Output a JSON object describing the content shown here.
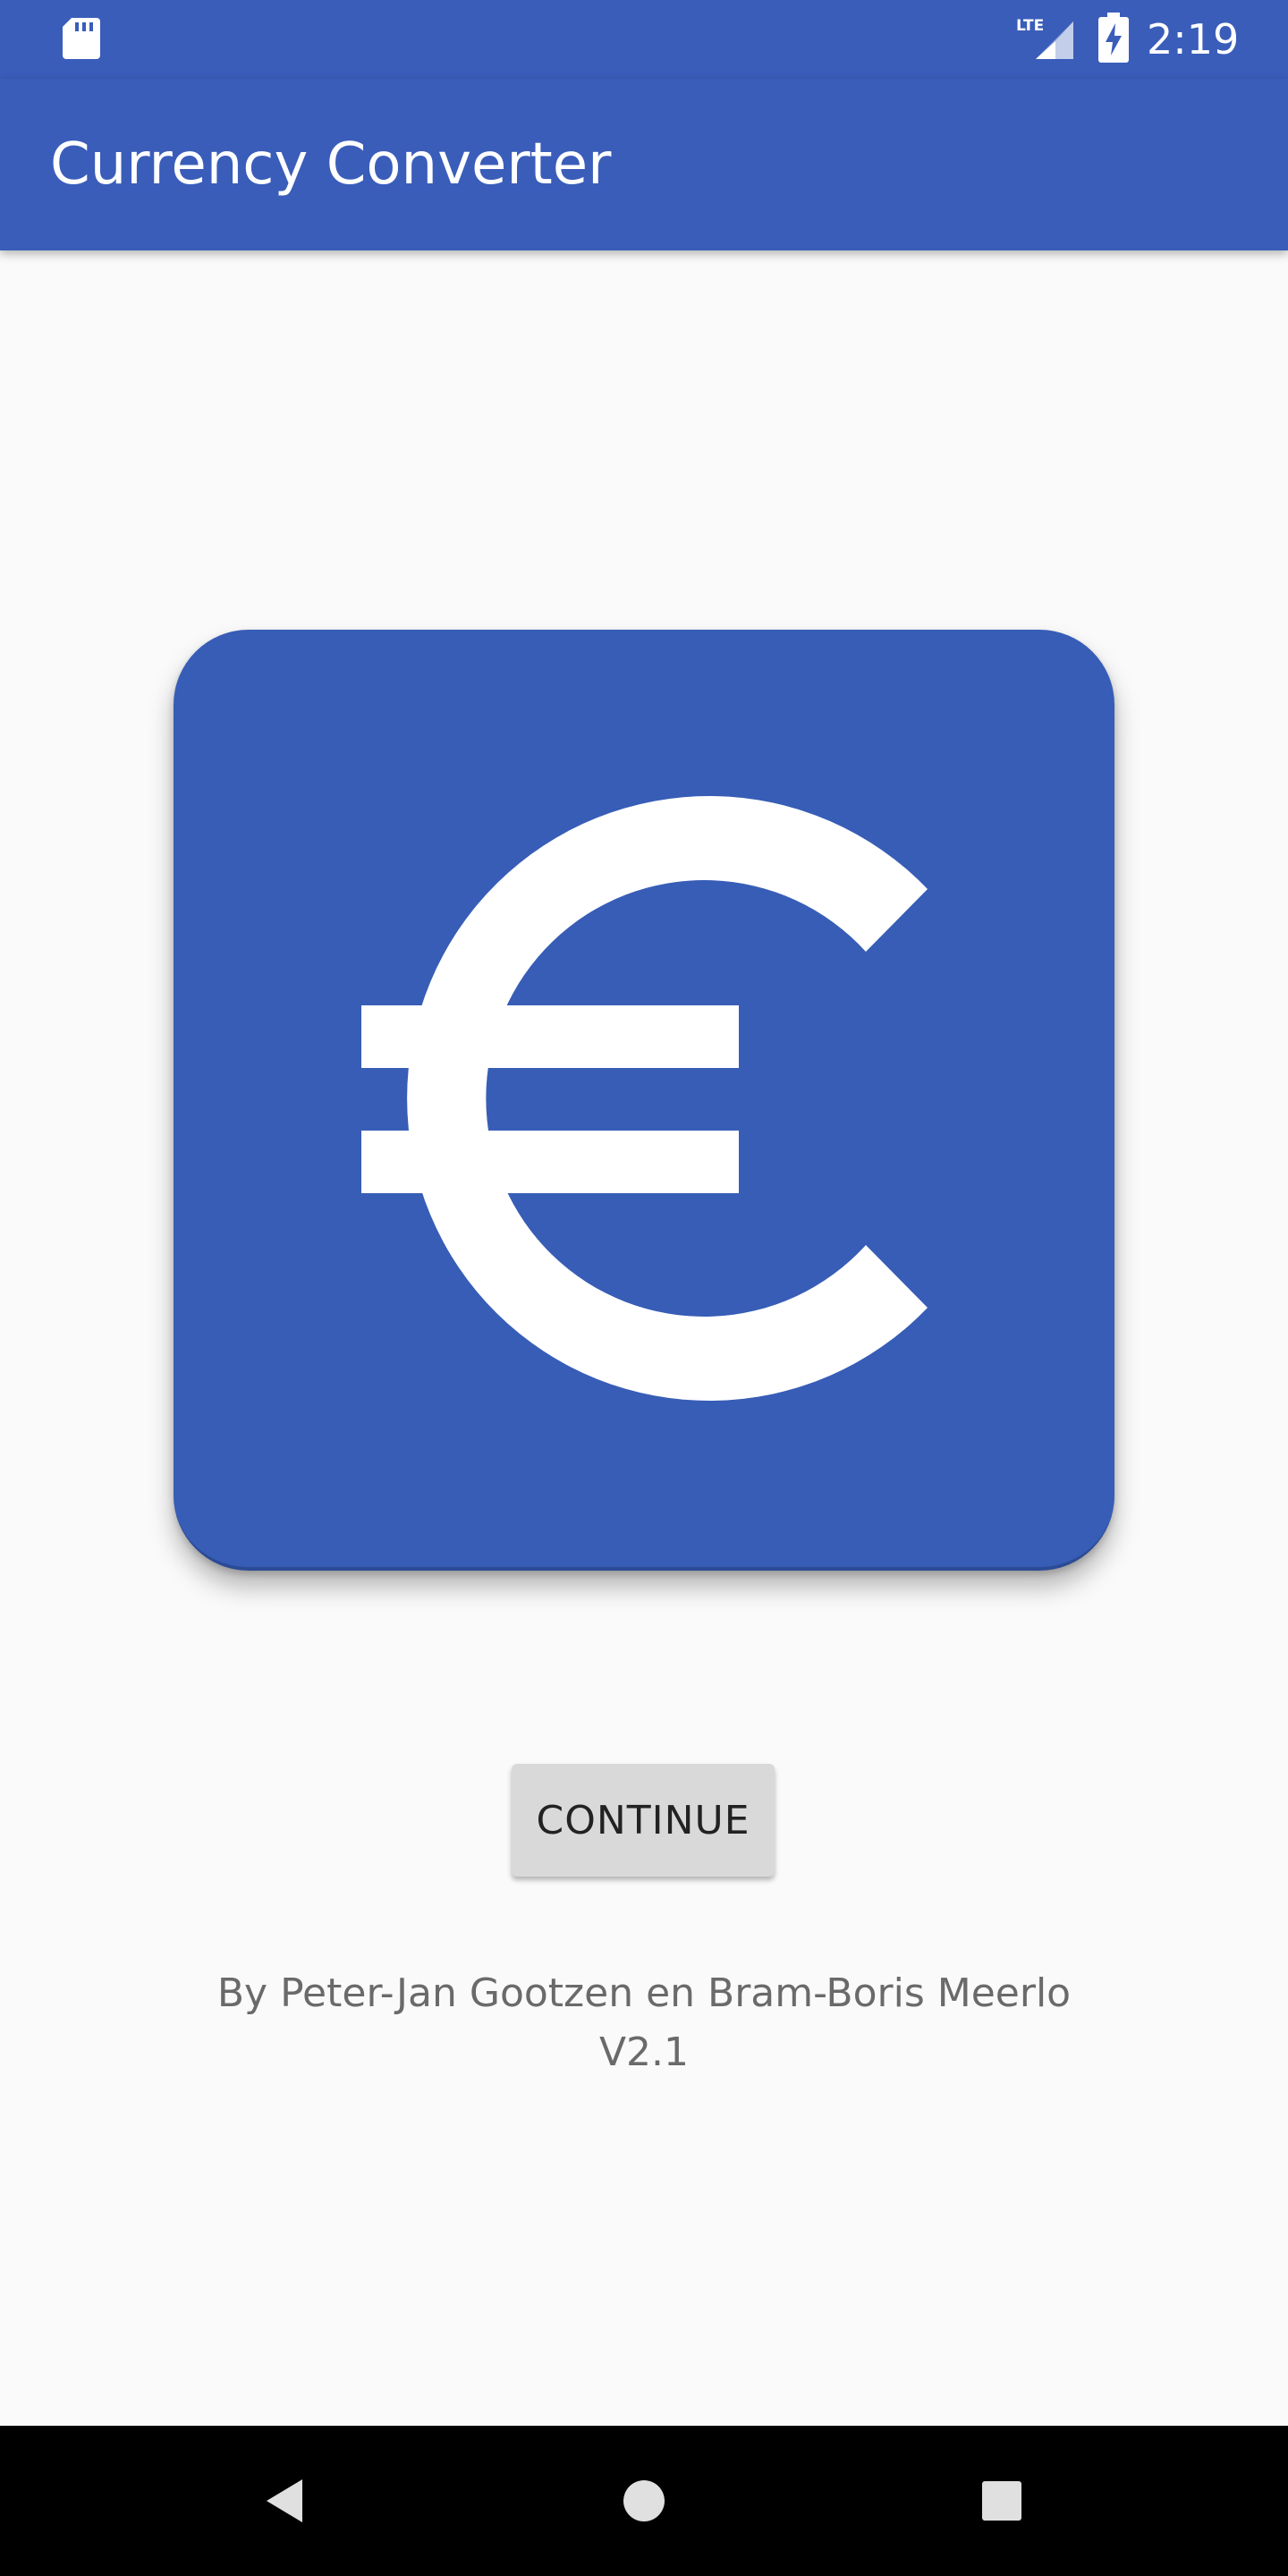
{
  "status_bar": {
    "time": "2:19",
    "network_label": "LTE",
    "icons": [
      "sd-card-icon",
      "lte-signal-icon",
      "battery-charging-icon"
    ]
  },
  "app_bar": {
    "title": "Currency Converter"
  },
  "logo": {
    "icon": "euro-icon",
    "background_color": "#375db6",
    "symbol_color": "#ffffff"
  },
  "main": {
    "continue_label": "CONTINUE",
    "credits_line1": "By Peter-Jan Gootzen en Bram-Boris Meerlo",
    "version": "V2.1"
  },
  "nav_bar": {
    "icons": [
      "back-icon",
      "home-icon",
      "recents-icon"
    ]
  },
  "colors": {
    "primary": "#3a5dba",
    "background": "#fafafa",
    "button": "#d9d9d9",
    "credits_text": "#6a6a6a"
  }
}
